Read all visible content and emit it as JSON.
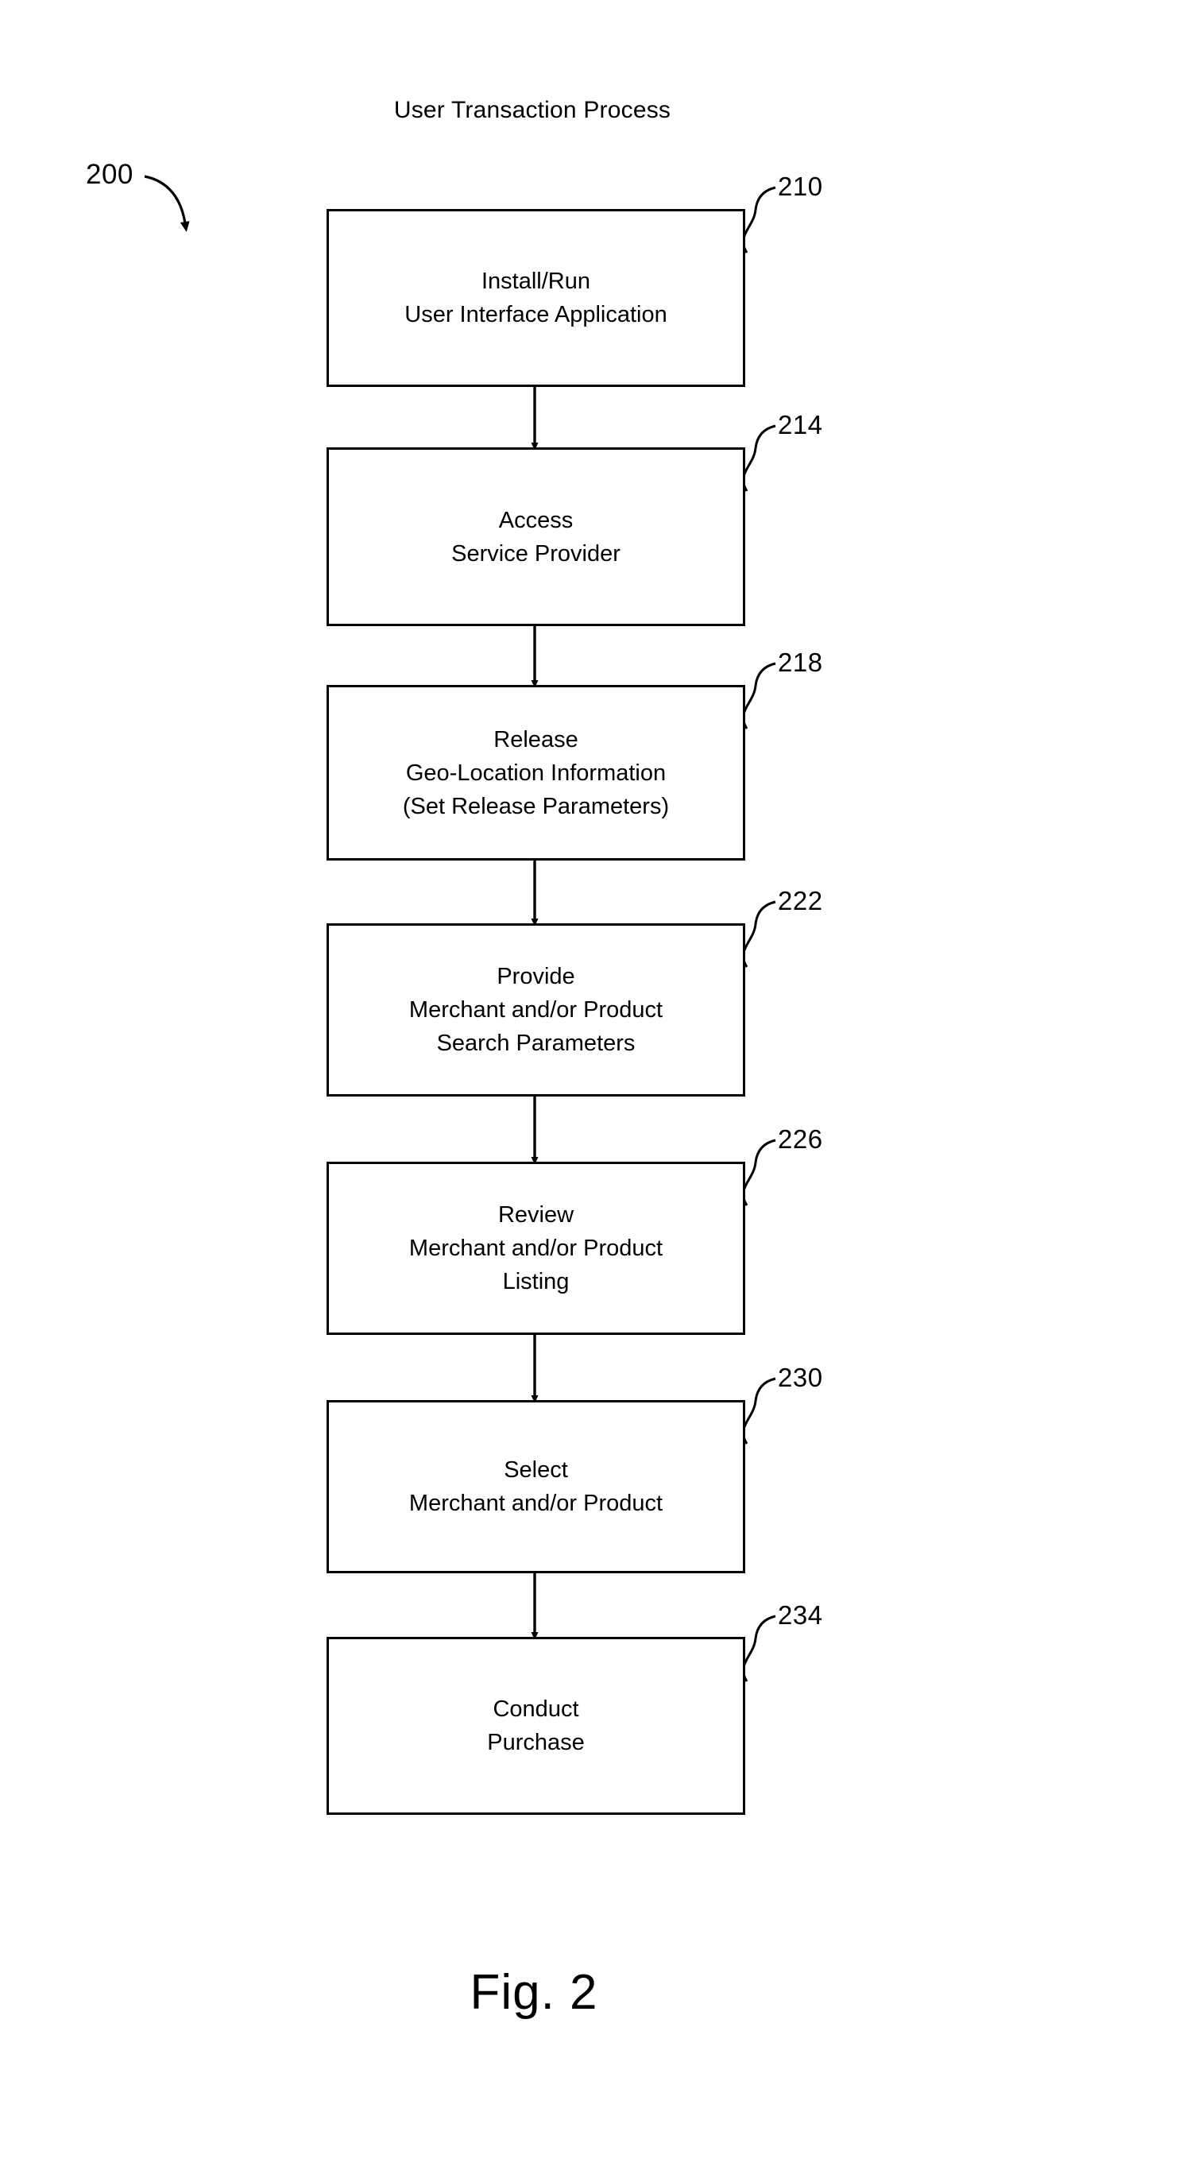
{
  "figure": {
    "title": "User Transaction Process",
    "caption": "Fig. 2",
    "overall_reference": "200"
  },
  "diagram": {
    "type": "flowchart",
    "orientation": "vertical",
    "stroke_color": "#000000",
    "background_color": "#ffffff",
    "steps": [
      {
        "ref": "210",
        "lines": [
          "Install/Run",
          "User Interface Application"
        ]
      },
      {
        "ref": "214",
        "lines": [
          "Access",
          "Service Provider"
        ]
      },
      {
        "ref": "218",
        "lines": [
          "Release",
          "Geo-Location Information",
          "(Set Release Parameters)"
        ]
      },
      {
        "ref": "222",
        "lines": [
          "Provide",
          "Merchant and/or Product",
          "Search Parameters"
        ]
      },
      {
        "ref": "226",
        "lines": [
          "Review",
          "Merchant and/or Product",
          "Listing"
        ]
      },
      {
        "ref": "230",
        "lines": [
          "Select",
          "Merchant and/or Product"
        ]
      },
      {
        "ref": "234",
        "lines": [
          "Conduct",
          "Purchase"
        ]
      }
    ]
  }
}
